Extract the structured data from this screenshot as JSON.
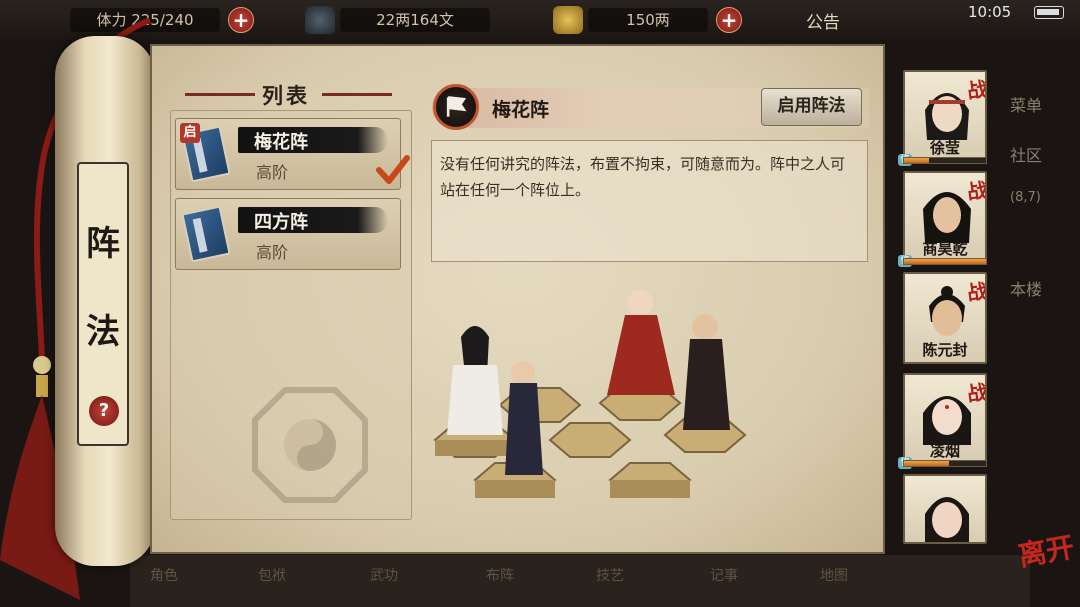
{
  "topbar": {
    "stamina": "体力 225/240",
    "silver": "22两164文",
    "gold": "150两",
    "notice": "公告",
    "time": "10:05"
  },
  "background_menu": {
    "side": [
      "菜单",
      "社区",
      "(8,7)",
      "本楼"
    ],
    "bottom": [
      "角色",
      "包袱",
      "武功",
      "布阵",
      "技艺",
      "记事",
      "地图"
    ]
  },
  "scroll": {
    "char1": "阵",
    "char2": "法",
    "help": "?"
  },
  "list": {
    "title": "列表",
    "items": [
      {
        "name": "梅花阵",
        "grade": "高阶",
        "badge": "启",
        "selected": true
      },
      {
        "name": "四方阵",
        "grade": "高阶",
        "badge": "",
        "selected": false
      }
    ]
  },
  "detail": {
    "title": "梅花阵",
    "enable_button": "启用阵法",
    "description": "没有任何讲究的阵法，布置不拘束，可随意而为。阵中之人可站在任何一个阵位上。"
  },
  "heroes": [
    {
      "name": "徐莹",
      "battle": "战",
      "bar_fill": 0.3
    },
    {
      "name": "商昊乾",
      "battle": "战",
      "bar_fill": 1.0
    },
    {
      "name": "陈元封",
      "battle": "战",
      "bar_fill": null
    },
    {
      "name": "凌烟",
      "battle": "战",
      "bar_fill": 0.55
    },
    {
      "name": "",
      "battle": "",
      "bar_fill": null
    }
  ],
  "leave": "离开",
  "colors": {
    "accent_red": "#b01d15",
    "parchment": "#ddd0b2",
    "name_bar": "#111111"
  }
}
